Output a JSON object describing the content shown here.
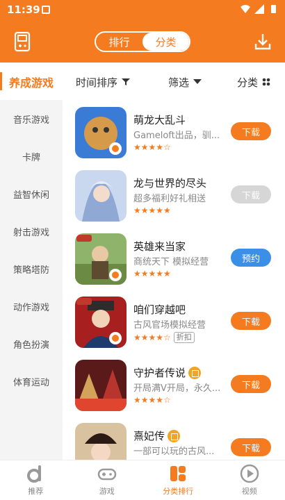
{
  "status": {
    "time": "11:39"
  },
  "header": {
    "left_icon": "gameboy-icon",
    "right_icon": "download-icon",
    "tabs": [
      {
        "label": "排行",
        "active": false
      },
      {
        "label": "分类",
        "active": true
      }
    ]
  },
  "filters": {
    "sort_label": "时间排序",
    "screen_label": "筛选",
    "category_label": "分类"
  },
  "sidebar": {
    "active_label": "养成游戏",
    "items": [
      {
        "label": "音乐游戏"
      },
      {
        "label": "卡牌"
      },
      {
        "label": "益智休闲"
      },
      {
        "label": "射击游戏"
      },
      {
        "label": "策略塔防"
      },
      {
        "label": "动作游戏"
      },
      {
        "label": "角色扮演"
      },
      {
        "label": "体育运动"
      }
    ]
  },
  "games": [
    {
      "title": "萌龙大乱斗",
      "desc": "Gameloft出品，驯...",
      "rating": 4,
      "rating_text": "★★★★☆",
      "button": "下载",
      "button_style": "orange",
      "tag": "",
      "gift": false
    },
    {
      "title": "龙与世界的尽头",
      "desc": "超多福利好礼相送",
      "rating": 5,
      "rating_text": "★★★★★",
      "button": "下载",
      "button_style": "gray",
      "tag": "",
      "gift": false
    },
    {
      "title": "英雄来当家",
      "desc": "商统天下 模拟经营",
      "rating": 5,
      "rating_text": "★★★★★",
      "button": "预约",
      "button_style": "blue",
      "tag": "",
      "gift": false
    },
    {
      "title": "咱们穿越吧",
      "desc": "古风官场模拟经营",
      "rating": 4,
      "rating_text": "★★★★☆",
      "button": "下载",
      "button_style": "orange",
      "tag": "折扣",
      "gift": false
    },
    {
      "title": "守护者传说",
      "desc": "开局满V开局，永久...",
      "rating": 4,
      "rating_text": "★★★★☆",
      "button": "下载",
      "button_style": "orange",
      "tag": "",
      "gift": true
    },
    {
      "title": "熹妃传",
      "desc": "一部可以玩的古风...",
      "rating": 0,
      "rating_text": "",
      "button": "下载",
      "button_style": "orange",
      "tag": "",
      "gift": true
    }
  ],
  "nav": [
    {
      "label": "推荐",
      "icon": "recommend-icon",
      "active": false
    },
    {
      "label": "游戏",
      "icon": "gamepad-icon",
      "active": false
    },
    {
      "label": "分类排行",
      "icon": "category-rank-icon",
      "active": true
    },
    {
      "label": "视频",
      "icon": "video-play-icon",
      "active": false
    }
  ],
  "colors": {
    "accent": "#f47b20",
    "blue": "#3b8fe6",
    "gray": "#d6d6d6"
  }
}
